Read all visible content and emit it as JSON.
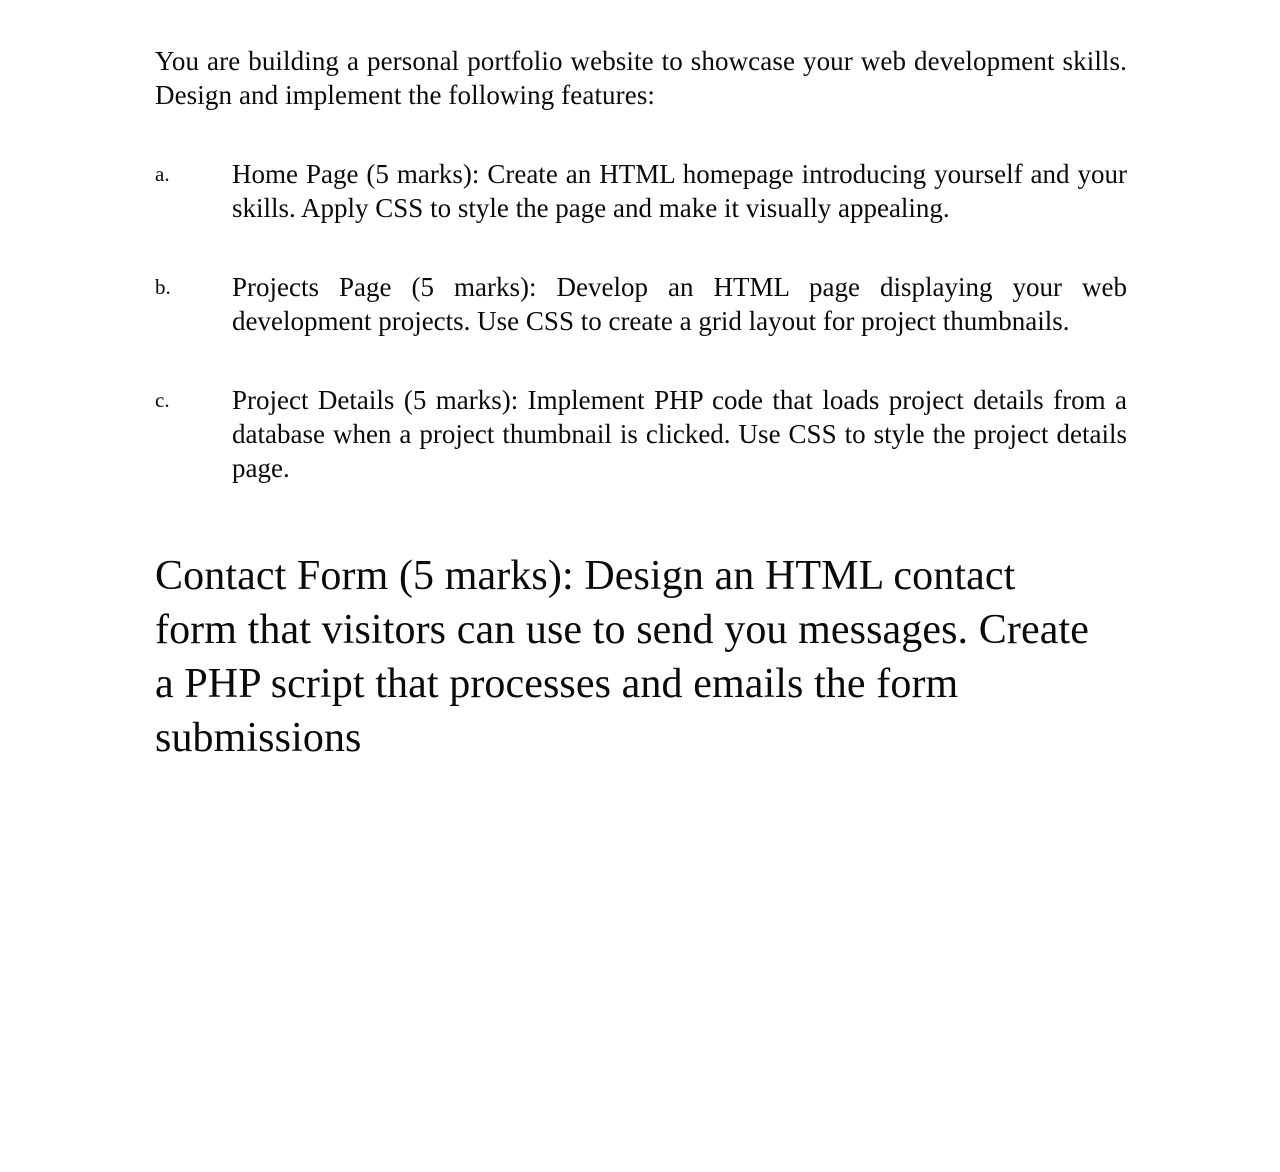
{
  "document": {
    "background_color": "#ffffff",
    "text_color": "#0a0a0a",
    "intro": "You are building a personal portfolio website to showcase your web development skills. Design and implement the following features:",
    "list": [
      {
        "marker": "a.",
        "text": "Home Page (5 marks): Create an HTML homepage introducing yourself and your skills. Apply CSS to style the page and make it visually appealing."
      },
      {
        "marker": "b.",
        "text": "Projects Page (5 marks): Develop an HTML page displaying your web development projects. Use CSS to create a grid layout for project thumbnails."
      },
      {
        "marker": "c.",
        "text": "Project Details (5 marks): Implement PHP code that loads project details from a database when a project thumbnail is clicked. Use CSS to style the project details page."
      }
    ],
    "closing": "Contact Form (5 marks): Design an HTML contact form that visitors can use to send you messages. Create a PHP script that processes and emails the form submissions"
  }
}
